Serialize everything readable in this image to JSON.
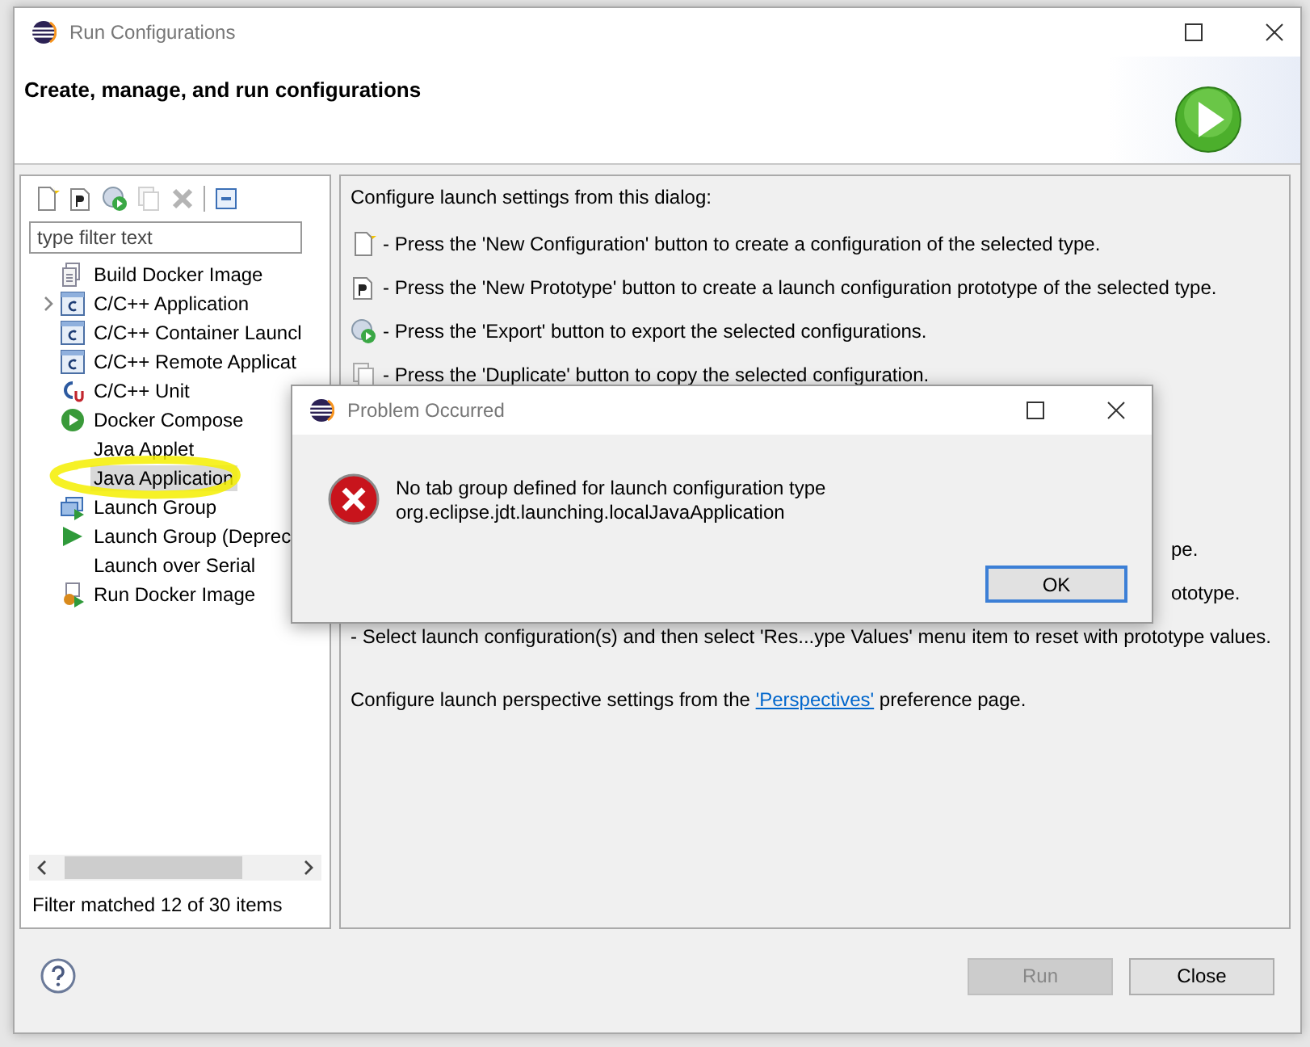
{
  "window": {
    "title": "Run Configurations",
    "header": "Create, manage, and run configurations"
  },
  "toolbar": [
    {
      "kind": "new",
      "disabled": false
    },
    {
      "kind": "prototype",
      "disabled": false
    },
    {
      "kind": "export",
      "disabled": false
    },
    {
      "kind": "duplicate",
      "disabled": true
    },
    {
      "kind": "delete",
      "disabled": true
    },
    {
      "kind": "collapse",
      "disabled": false
    }
  ],
  "filter": {
    "placeholder": "type filter text"
  },
  "tree": [
    {
      "label": "Build Docker Image",
      "kind": "docker-build",
      "selected": false
    },
    {
      "label": "C/C++ Application",
      "kind": "cpp",
      "selected": false,
      "expanded": false
    },
    {
      "label": "C/C++ Container Launcl",
      "kind": "cpp",
      "selected": false
    },
    {
      "label": "C/C++ Remote Applicat",
      "kind": "cpp",
      "selected": false
    },
    {
      "label": "C/C++ Unit",
      "kind": "cpp-unit",
      "selected": false
    },
    {
      "label": "Docker Compose",
      "kind": "docker-compose",
      "selected": false
    },
    {
      "label": "Java Applet",
      "kind": "none",
      "selected": false
    },
    {
      "label": "Java Application",
      "kind": "none",
      "selected": true
    },
    {
      "label": "Launch Group",
      "kind": "launch-group",
      "selected": false
    },
    {
      "label": "Launch Group (Deprec",
      "kind": "launch-arrow",
      "selected": false
    },
    {
      "label": "Launch over Serial",
      "kind": "none",
      "selected": false
    },
    {
      "label": "Run Docker Image",
      "kind": "docker-run",
      "selected": false
    }
  ],
  "filter_status": "Filter matched 12 of 30 items",
  "info": {
    "intro": "Configure launch settings from this dialog:",
    "lines": [
      {
        "kind": "new",
        "text": "- Press the 'New Configuration' button to create a configuration of the selected type."
      },
      {
        "kind": "prototype",
        "text": "- Press the 'New Prototype' button to create a launch configuration prototype of the selected type."
      },
      {
        "kind": "export",
        "text": "- Press the 'Export' button to export the selected configurations."
      },
      {
        "kind": "duplicate",
        "text": "- Press the 'Duplicate' button to copy the selected configuration."
      },
      {
        "kind": "fragment",
        "text": "pe."
      },
      {
        "kind": "fragment",
        "text": "ototype."
      },
      {
        "kind": "plain",
        "text": "- Select launch configuration(s) and then select 'Res...ype Values' menu item to reset with prototype values."
      }
    ],
    "footer_before": "Configure launch perspective settings from the ",
    "footer_link": "'Perspectives'",
    "footer_after": " preference page."
  },
  "buttons": [
    {
      "label": "Run",
      "disabled": true
    },
    {
      "label": "Close",
      "disabled": false
    }
  ],
  "dialog": {
    "title": "Problem Occurred",
    "message": "No tab group defined for launch configuration type\norg.eclipse.jdt.launching.localJavaApplication",
    "button": "OK"
  }
}
